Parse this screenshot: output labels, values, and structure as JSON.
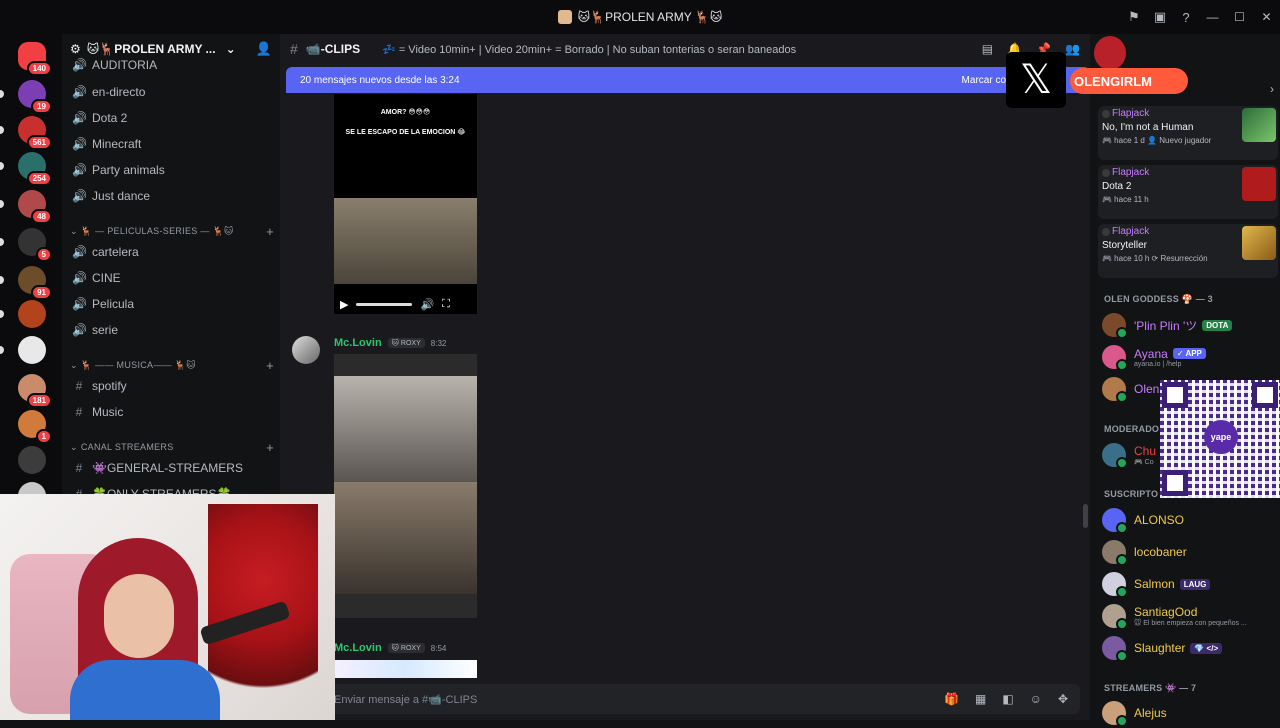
{
  "window": {
    "title": "🐱🦌PROLEN ARMY 🦌🐱"
  },
  "servers": [
    {
      "badge": "140"
    },
    {
      "badge": "19"
    },
    {
      "badge": "561"
    },
    {
      "badge": "254"
    },
    {
      "badge": "48"
    },
    {
      "badge": "5"
    },
    {
      "badge": "91"
    },
    {
      "badge": ""
    },
    {
      "badge": ""
    },
    {
      "badge": "181"
    },
    {
      "badge": "1"
    },
    {
      "badge": ""
    },
    {
      "badge": ""
    }
  ],
  "guild": {
    "name": "🐱🦌PROLEN ARMY ..."
  },
  "channels": {
    "partial_top": "AUDITORIA",
    "items_top": [
      "en-directo",
      "Dota 2",
      "Minecraft",
      "Party animals",
      "Just dance"
    ],
    "cat_movies": "🦌 — PELICULAS-SERIES — 🦌🐱",
    "items_movies": [
      "cartelera",
      "CINE",
      "Pelicula",
      "serie"
    ],
    "cat_music": "🦌 —— MUSICA—— 🦌🐱",
    "items_music": [
      "spotify",
      "Music"
    ],
    "cat_streamers": "CANAL STREAMERS",
    "items_streamers": [
      "👾GENERAL-STREAMERS",
      "🍀ONLY STREAMERS🍀"
    ]
  },
  "chat": {
    "channel_name": "📹-CLIPS",
    "topic": "💤 = Video 10min+ | Video 20min+ = Borrado | No suban tonterias o seran baneados",
    "new_messages": "20 mensajes nuevos desde las 3:24",
    "mark_read": "Marcar co",
    "video1_caption_top": "AMOR? 😳😳😳",
    "video1_caption_mid": "SE LE ESCAPO DE LA EMOCION 😂",
    "messages": [
      {
        "author": "Mc.Lovin",
        "tag": "🐱 ROXY",
        "time": "8:32"
      },
      {
        "author": "Mc.Lovin",
        "tag": "🐱 ROXY",
        "time": "8:54"
      }
    ],
    "composer_placeholder": "Enviar mensaje a #📹-CLIPS"
  },
  "overlay": {
    "x_logo": "𝕏",
    "handle": "OLENGIRLM"
  },
  "members": {
    "activities": [
      {
        "user": "Flapjack",
        "activity": "No, I'm not a Human",
        "meta": "🎮 hace 1 d   👤 Nuevo jugador"
      },
      {
        "user": "Flapjack",
        "activity": "Dota 2",
        "meta": "🎮 hace 11 h"
      },
      {
        "user": "Flapjack",
        "activity": "Storyteller",
        "meta": "🎮 hace 10 h   ⟳ Resurrección"
      }
    ],
    "section_goddess": "OLEN GODDESS 🍄 — 3",
    "goddess": [
      {
        "name": "'Plin Plin 'ツ",
        "badge": "DOTA"
      },
      {
        "name": "Ayana",
        "badge": "✓ APP",
        "sub": "ayana.io | /help"
      },
      {
        "name": "Olen"
      }
    ],
    "section_mod": "MODERADO",
    "mod": [
      {
        "name": "Chu",
        "sub": "🎮 Co"
      }
    ],
    "section_subs": "SUSCRIPTO",
    "subs": [
      {
        "name": "ALONSO"
      },
      {
        "name": "locobaner"
      },
      {
        "name": "Salmon",
        "badge": "LAUG"
      },
      {
        "name": "SantiagOod",
        "sub": "🐭 El bien empieza con pequeños ..."
      },
      {
        "name": "Slaughter",
        "badge": "💎 </>"
      }
    ],
    "section_streamers": "STREAMERS 👾 — 7",
    "streamers": [
      {
        "name": "Alejus"
      }
    ],
    "qr_label": "yape"
  },
  "colors": {
    "accent": "#5865f2",
    "author_green": "#2dc770",
    "sub_gold": "#f0c94a",
    "pill_orange": "#ff5a3c"
  }
}
